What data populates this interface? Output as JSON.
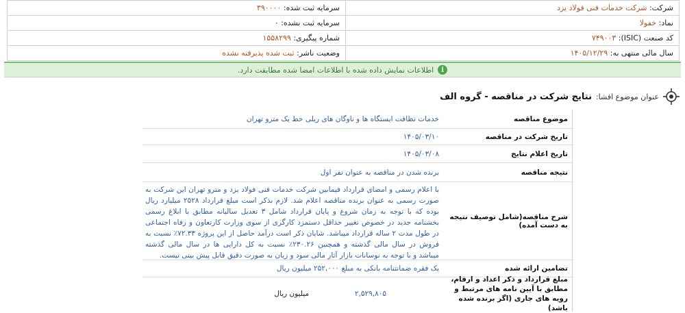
{
  "header": {
    "company_label": "شرکت:",
    "company_value": "شرکت خدمات فنی فولاد یزد",
    "capital_reg_label": "سرمایه ثبت شده:",
    "capital_reg_value": "۳۹۰۰۰۰",
    "symbol_label": "نماد:",
    "symbol_value": "خفولا",
    "capital_unreg_label": "سرمایه ثبت نشده:",
    "capital_unreg_value": "۰",
    "isic_label": "کد صنعت (ISIC):",
    "isic_value": "۷۴۹۰۰۳",
    "tracking_label": "شماره پیگیری:",
    "tracking_value": "۱۵۵۸۲۹۹",
    "fiscal_label": "سال مالی منتهی به:",
    "fiscal_value": "۱۴۰۵/۱۲/۲۹",
    "publisher_status_label": "وضعیت ناشر:",
    "publisher_status_value": "ثبت شده پذیرفته نشده"
  },
  "banner": {
    "text": "اطلاعات نمایش داده شده با اطلاعات امضا شده مطابقت دارد.",
    "color": "#dff0d8"
  },
  "subject": {
    "prefix": "عنوان موضوع افشا:",
    "title": "نتایج شرکت در مناقصه - گروه الف"
  },
  "details": {
    "topic_label": "موضوع مناقصه",
    "topic_value": "خدمات نظافت ایستگاه ها و ناوگان های ریلی خط یک مترو تهران",
    "participation_date_label": "تاریخ شرکت در مناقصه",
    "participation_date_value": "۱۴۰۵/۰۳/۱۰",
    "results_date_label": "تاریخ اعلام نتایج",
    "results_date_value": "۱۴۰۵/۰۳/۰۸",
    "result_label": "نتیجه مناقصه",
    "result_value": "برنده شدن در مناقصه به عنوان نفر اول",
    "description_label": "شرح مناقصه(شامل توصیف نتیجه به دست آمده)",
    "description_value": "با اعلام رسمی و امضای قرارداد فیمابین شرکت خدمات فنی فولاد یزد و مترو تهران این شرکت به صورت رسمی به عنوان برنده مناقصه اعلام شد. لازم بذکر است مبلغ قرارداد ۲۵۲۸ میلیارد ریال بوده که با توجه به زمان شروع و پایان قرارداد شامل ۳ تعدیل سالیانه مطابق با ابلاغ رسمی بخشنامه جدید در خصوص تغییر حداقل دستمزد کارگری از سوی وزارت کارتعاون و رفاه اجتماعی در طول مدت ۲ ساله قرارداد میباشد. شایان ذکر است درآمد حاصل از این پروژه ۷۲.۳۳٪ نسبت به فروش در سال مالی گذشته و همچنین ۲۳۰.۲۶٪ نسبت به کل دارایی ها در سال مالی گذشته میباشد و با توجه به نوسانات بازار آثار مالی سود و زیان به صورت دقیق قابل پیش بینی نیست.",
    "guarantee_label": "تضامین ارائه شده",
    "guarantee_value": "یک فقره ضمانتنامه بانکی به مبلغ ۲۵۲,۰۰۰ میلیون ریال",
    "amount_label": "مبلغ قرارداد و ذکر اعداد و ارقام، مطابق با آیین نامه های مرتبط و رویه های جاری (اگر برنده شده باشد)",
    "amount_value": "۲,۵۲۹,۸۰۵",
    "amount_unit": "میلیون ریال"
  }
}
